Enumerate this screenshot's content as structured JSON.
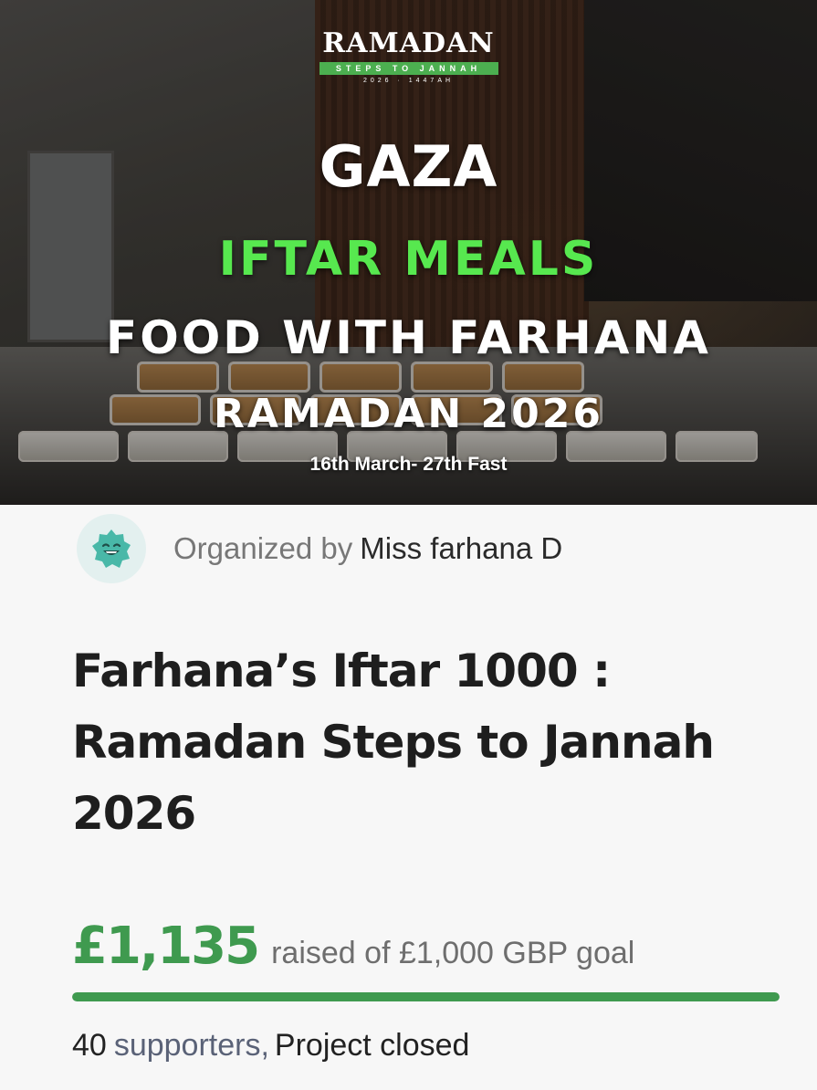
{
  "banner": {
    "logo": {
      "word": "RAMADAN",
      "strip": "STEPS TO JANNAH",
      "year": "2026 · 1447AH"
    },
    "line_gaza": "GAZA",
    "line_iftar": "IFTAR MEALS",
    "line_food": "FOOD WITH FARHANA",
    "line_ramadan": "RAMADAN 2026",
    "line_dates": "16th March- 27th Fast"
  },
  "organizer": {
    "prefix": "Organized by",
    "name": "Miss farhana D",
    "avatar_icon": "smiling-star-avatar-icon"
  },
  "campaign": {
    "title": "Farhana’s Iftar 1000 : Ramadan Steps to Jannah 2026"
  },
  "funding": {
    "raised": "£1,135",
    "goal_text": "raised of £1,000 GBP goal",
    "progress_percent": 100
  },
  "supporters": {
    "count": "40",
    "label": "supporters,",
    "status": "Project closed"
  },
  "colors": {
    "accent_green": "#3f9a4f",
    "banner_green": "#57e84f",
    "avatar_bg": "#e3f0ef",
    "avatar_icon": "#49b8a8"
  }
}
